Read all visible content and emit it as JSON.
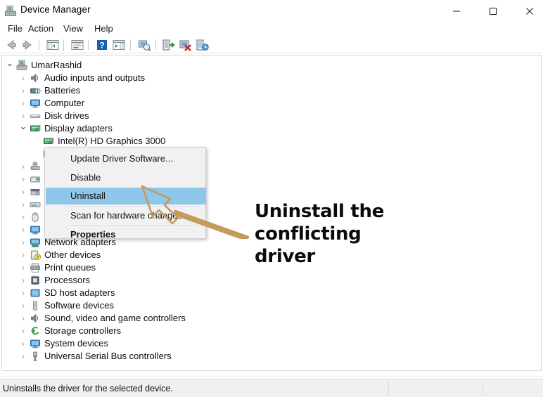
{
  "window": {
    "title": "Device Manager",
    "icon": "device-manager-icon",
    "controls": {
      "minimize": "—",
      "maximize": "□",
      "close": "✕"
    }
  },
  "menubar": {
    "items": [
      "File",
      "Action",
      "View",
      "Help"
    ]
  },
  "toolbar": {
    "icons": [
      "back-arrow-icon",
      "forward-arrow-icon",
      "show-hide-console-tree-icon",
      "properties-icon",
      "help-icon",
      "scan-icon",
      "update-driver-icon",
      "disable-device-icon",
      "uninstall-device-icon",
      "scan-hardware-changes-icon"
    ]
  },
  "tree": {
    "root": {
      "label": "UmarRashid",
      "icon": "computer-tower-icon",
      "expanded": true
    },
    "nodes": [
      {
        "label": "Audio inputs and outputs",
        "icon": "speaker-icon",
        "expanded": false,
        "indent": 1
      },
      {
        "label": "Batteries",
        "icon": "battery-icon",
        "expanded": false,
        "indent": 1
      },
      {
        "label": "Computer",
        "icon": "monitor-icon",
        "expanded": false,
        "indent": 1
      },
      {
        "label": "Disk drives",
        "icon": "disk-drive-icon",
        "expanded": false,
        "indent": 1
      },
      {
        "label": "Display adapters",
        "icon": "display-adapter-icon",
        "expanded": true,
        "indent": 1
      },
      {
        "label": "Intel(R) HD Graphics 3000",
        "icon": "display-adapter-icon",
        "expanded": null,
        "indent": 2
      },
      {
        "label": "",
        "icon": "display-adapter-icon",
        "expanded": null,
        "indent": 2
      },
      {
        "label": "",
        "icon": "camera-icon",
        "expanded": false,
        "indent": 1
      },
      {
        "label": "",
        "icon": "card-reader-icon",
        "expanded": false,
        "indent": 1
      },
      {
        "label": "",
        "icon": "imaging-device-icon",
        "expanded": false,
        "indent": 1
      },
      {
        "label": "",
        "icon": "keyboard-icon",
        "expanded": false,
        "indent": 1
      },
      {
        "label": "",
        "icon": "mouse-icon",
        "expanded": false,
        "indent": 1
      },
      {
        "label": "",
        "icon": "monitor-icon",
        "expanded": false,
        "indent": 1
      },
      {
        "label": "Network adapters",
        "icon": "network-adapter-icon",
        "expanded": false,
        "indent": 1
      },
      {
        "label": "Other devices",
        "icon": "unknown-device-icon",
        "expanded": false,
        "indent": 1
      },
      {
        "label": "Print queues",
        "icon": "printer-icon",
        "expanded": false,
        "indent": 1
      },
      {
        "label": "Processors",
        "icon": "processor-icon",
        "expanded": false,
        "indent": 1
      },
      {
        "label": "SD host adapters",
        "icon": "sd-host-icon",
        "expanded": false,
        "indent": 1
      },
      {
        "label": "Software devices",
        "icon": "software-device-icon",
        "expanded": false,
        "indent": 1
      },
      {
        "label": "Sound, video and game controllers",
        "icon": "speaker-icon",
        "expanded": false,
        "indent": 1
      },
      {
        "label": "Storage controllers",
        "icon": "storage-controller-icon",
        "expanded": false,
        "indent": 1
      },
      {
        "label": "System devices",
        "icon": "monitor-icon",
        "expanded": false,
        "indent": 1
      },
      {
        "label": "Universal Serial Bus controllers",
        "icon": "usb-icon",
        "expanded": false,
        "indent": 1
      }
    ]
  },
  "context_menu": {
    "items": [
      {
        "label": "Update Driver Software...",
        "selected": false,
        "bold": false
      },
      {
        "label": "Disable",
        "selected": false,
        "bold": false
      },
      {
        "label": "Uninstall",
        "selected": true,
        "bold": false
      },
      {
        "label": "Scan for hardware changes",
        "selected": false,
        "bold": false
      },
      {
        "label": "Properties",
        "selected": false,
        "bold": true
      }
    ],
    "highlight_color": "#8ec7ea"
  },
  "annotation": {
    "text": "Uninstall the conflicting driver",
    "arrow_color": "#c59a5b"
  },
  "statusbar": {
    "message": "Uninstalls the driver for the selected device."
  }
}
